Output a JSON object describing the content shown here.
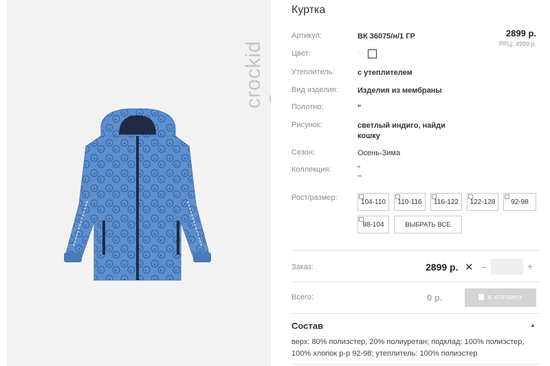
{
  "brand": {
    "name": "crockid"
  },
  "product": {
    "title": "Куртка",
    "price": "2899 р.",
    "rrp_label": "РРЦ:",
    "rrp_value": "4999 р."
  },
  "attributes": {
    "article": {
      "label": "Артикул:",
      "value": "ВК 36075/н/1 ГР"
    },
    "color": {
      "label": "Цвет:"
    },
    "insulation": {
      "label": "Утеплитель:",
      "value": "с утеплителем"
    },
    "type": {
      "label": "Вид изделия:",
      "value": "Изделия из мембраны"
    },
    "fabric": {
      "label": "Полотно:",
      "value": "\""
    },
    "pattern": {
      "label": "Рисунок:",
      "value": "светлый индиго, найди кошку"
    },
    "season": {
      "label": "Сезон:",
      "value": "Осень-Зима"
    },
    "collection": {
      "label": "Коллекция:",
      "value": "\"",
      "value2": "–"
    }
  },
  "sizes": {
    "label": "Рост/размер:",
    "items": [
      "104-110",
      "110-116",
      "116-122",
      "122-128",
      "92-98",
      "98-104"
    ],
    "select_all": "ВЫБРАТЬ ВСЕ"
  },
  "order": {
    "label": "Заказ:",
    "price": "2899 р.",
    "times": "✕",
    "minus": "–",
    "plus": "+"
  },
  "total": {
    "label": "Всего:",
    "value": "0 р.",
    "cart_button": "В КОРЗИНУ"
  },
  "composition": {
    "title": "Состав",
    "text": "верх: 80% полиэстер, 20% полиуретан; подклад: 100% полиэстер, 100% хлопок р-р 92-98; утеплитель: 100% полиэстер"
  },
  "colors": {
    "jacket": "#5b8fd0",
    "accent_text": "#333333",
    "muted": "#8c8c8c"
  }
}
